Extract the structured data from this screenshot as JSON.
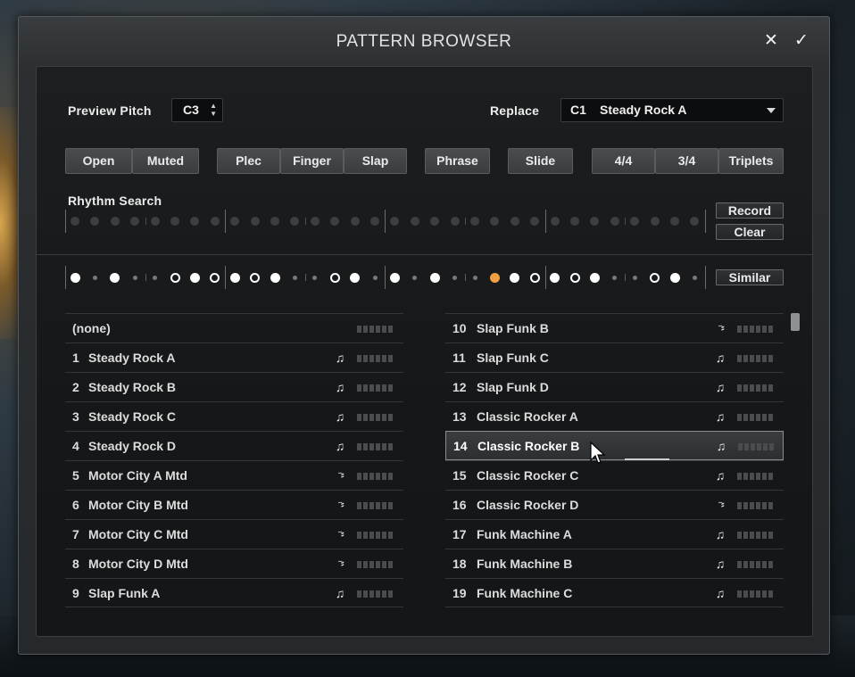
{
  "window": {
    "title": "PATTERN BROWSER",
    "close_glyph": "✕",
    "ok_glyph": "✓"
  },
  "preview_pitch": {
    "label": "Preview Pitch",
    "value": "C3"
  },
  "replace": {
    "label": "Replace",
    "key": "C1",
    "value": "Steady Rock A"
  },
  "buttons": {
    "open": "Open",
    "muted": "Muted",
    "plec": "Plec",
    "finger": "Finger",
    "slap": "Slap",
    "phrase": "Phrase",
    "slide": "Slide",
    "time_4_4": "4/4",
    "time_3_4": "3/4",
    "triplets": "Triplets",
    "record": "Record",
    "clear": "Clear",
    "similar": "Similar"
  },
  "rhythm_search": {
    "label": "Rhythm Search"
  },
  "pattern_steps": [
    "filled",
    "small",
    "filled",
    "small",
    "small",
    "ring",
    "filled",
    "ring",
    "filled",
    "ring",
    "filled",
    "small",
    "small",
    "ring",
    "filled",
    "small",
    "filled",
    "small",
    "filled",
    "small",
    "small",
    "accent",
    "filled",
    "ring",
    "filled",
    "ring",
    "filled",
    "small",
    "small",
    "ring",
    "filled",
    "small"
  ],
  "colors": {
    "accent": "#f0a040",
    "filled": "#ffffff",
    "ring": "#ffffff",
    "small": "#777a7d"
  },
  "left_list": [
    {
      "num": "",
      "name": "(none)",
      "icon": ""
    },
    {
      "num": "1",
      "name": "Steady Rock A",
      "icon": "note-icon"
    },
    {
      "num": "2",
      "name": "Steady Rock B",
      "icon": "note-icon"
    },
    {
      "num": "3",
      "name": "Steady Rock C",
      "icon": "note-icon"
    },
    {
      "num": "4",
      "name": "Steady Rock D",
      "icon": "note-icon"
    },
    {
      "num": "5",
      "name": "Motor City A Mtd",
      "icon": "muted-icon"
    },
    {
      "num": "6",
      "name": "Motor City B Mtd",
      "icon": "muted-icon"
    },
    {
      "num": "7",
      "name": "Motor City C Mtd",
      "icon": "muted-icon"
    },
    {
      "num": "8",
      "name": "Motor City D Mtd",
      "icon": "muted-icon"
    },
    {
      "num": "9",
      "name": "Slap Funk A",
      "icon": "note-icon"
    }
  ],
  "right_list": [
    {
      "num": "10",
      "name": "Slap Funk B",
      "icon": "muted-icon"
    },
    {
      "num": "11",
      "name": "Slap Funk C",
      "icon": "note-icon"
    },
    {
      "num": "12",
      "name": "Slap Funk D",
      "icon": "note-icon"
    },
    {
      "num": "13",
      "name": "Classic Rocker A",
      "icon": "note-icon"
    },
    {
      "num": "14",
      "name": "Classic Rocker B",
      "icon": "note-icon",
      "selected": true
    },
    {
      "num": "15",
      "name": "Classic Rocker C",
      "icon": "note-icon"
    },
    {
      "num": "16",
      "name": "Classic Rocker D",
      "icon": "muted-icon"
    },
    {
      "num": "17",
      "name": "Funk Machine A",
      "icon": "note-icon"
    },
    {
      "num": "18",
      "name": "Funk Machine B",
      "icon": "note-icon"
    },
    {
      "num": "19",
      "name": "Funk Machine C",
      "icon": "note-icon"
    }
  ]
}
